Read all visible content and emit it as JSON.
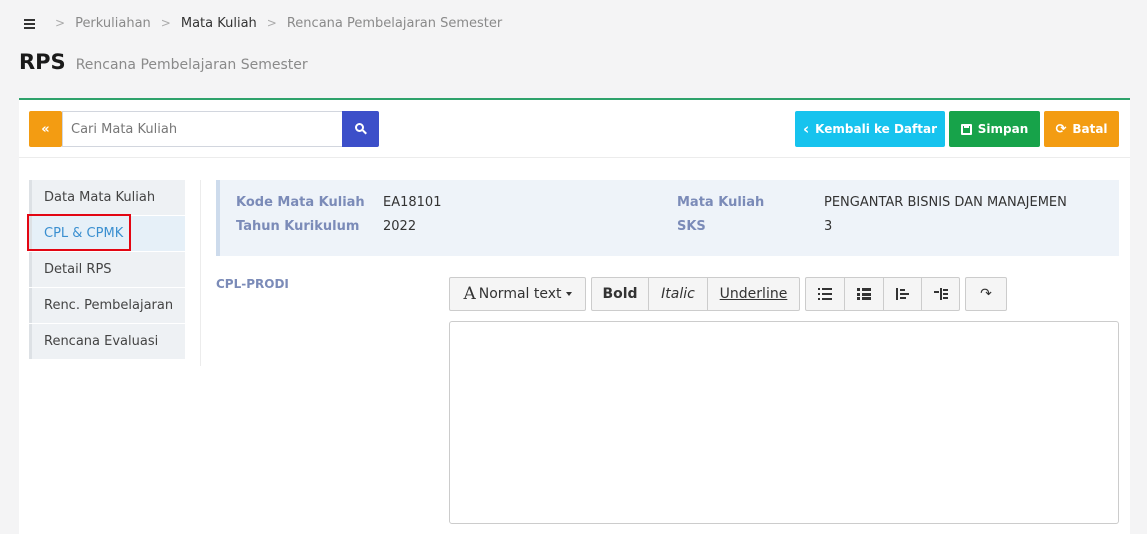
{
  "breadcrumb": {
    "items": [
      "Perkuliahan",
      "Mata Kuliah",
      "Rencana Pembelajaran Semester"
    ],
    "separator": ">"
  },
  "page": {
    "title": "RPS",
    "subtitle": "Rencana Pembelajaran Semester"
  },
  "toolbar": {
    "collapse_label": "«",
    "search_placeholder": "Cari Mata Kuliah",
    "search_value": "",
    "back_label": "Kembali ke Daftar",
    "back_icon": "‹",
    "save_label": "Simpan",
    "cancel_label": "Batal",
    "cancel_icon": "⟳"
  },
  "sidebar": {
    "items": [
      {
        "label": "Data Mata Kuliah"
      },
      {
        "label": "CPL & CPMK"
      },
      {
        "label": "Detail RPS"
      },
      {
        "label": "Renc. Pembelajaran"
      },
      {
        "label": "Rencana Evaluasi"
      }
    ],
    "active_index": 1
  },
  "course_info": {
    "kode_label": "Kode Mata Kuliah",
    "kode_value": "EA18101",
    "tahun_label": "Tahun Kurikulum",
    "tahun_value": "2022",
    "mk_label": "Mata Kuliah",
    "mk_value": "PENGANTAR BISNIS DAN MANAJEMEN",
    "sks_label": "SKS",
    "sks_value": "3"
  },
  "cpl": {
    "label": "CPL-PRODI"
  },
  "editor": {
    "heading_icon": "A",
    "heading_label": "Normal text",
    "bold_label": "Bold",
    "italic_label": "Italic",
    "underline_label": "Underline",
    "content": ""
  },
  "colors": {
    "accent_green": "#2ea26b",
    "btn_orange": "#f39c12",
    "btn_blue": "#3c4fc9",
    "btn_cyan": "#16c3ee",
    "btn_green": "#17a34a",
    "highlight_red": "#e30613"
  }
}
